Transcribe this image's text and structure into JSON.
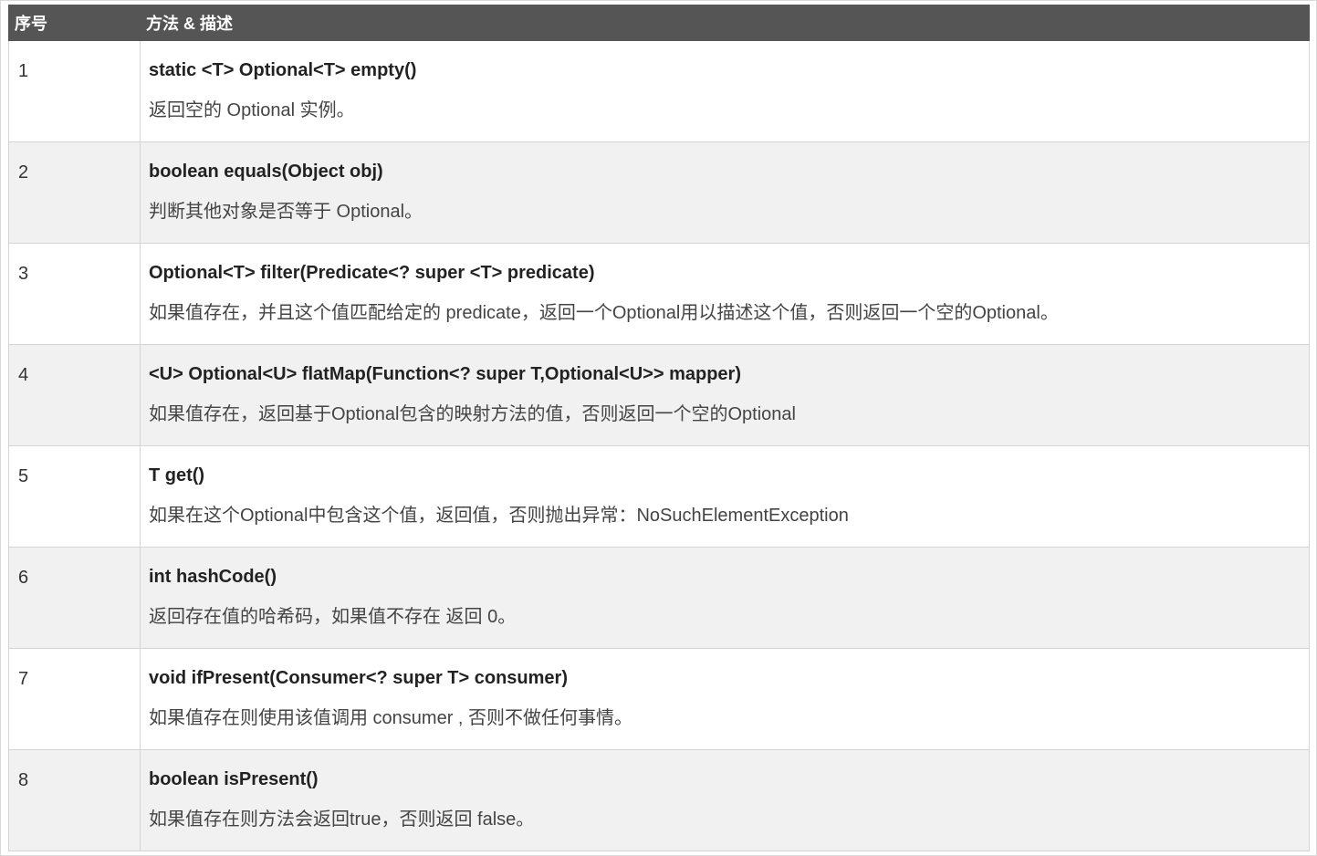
{
  "header": {
    "col_num": "序号",
    "col_method": "方法 & 描述"
  },
  "rows": [
    {
      "num": "1",
      "signature": "static <T> Optional<T> empty()",
      "description": "返回空的 Optional 实例。"
    },
    {
      "num": "2",
      "signature": "boolean equals(Object obj)",
      "description": "判断其他对象是否等于 Optional。"
    },
    {
      "num": "3",
      "signature": "Optional<T> filter(Predicate<? super <T> predicate)",
      "description": "如果值存在，并且这个值匹配给定的 predicate，返回一个Optional用以描述这个值，否则返回一个空的Optional。"
    },
    {
      "num": "4",
      "signature": "<U> Optional<U> flatMap(Function<? super T,Optional<U>> mapper)",
      "description": "如果值存在，返回基于Optional包含的映射方法的值，否则返回一个空的Optional"
    },
    {
      "num": "5",
      "signature": "T get()",
      "description": "如果在这个Optional中包含这个值，返回值，否则抛出异常：NoSuchElementException"
    },
    {
      "num": "6",
      "signature": "int hashCode()",
      "description": "返回存在值的哈希码，如果值不存在 返回 0。"
    },
    {
      "num": "7",
      "signature": "void ifPresent(Consumer<? super T> consumer)",
      "description": "如果值存在则使用该值调用 consumer , 否则不做任何事情。"
    },
    {
      "num": "8",
      "signature": "boolean isPresent()",
      "description": "如果值存在则方法会返回true，否则返回 false。"
    }
  ]
}
